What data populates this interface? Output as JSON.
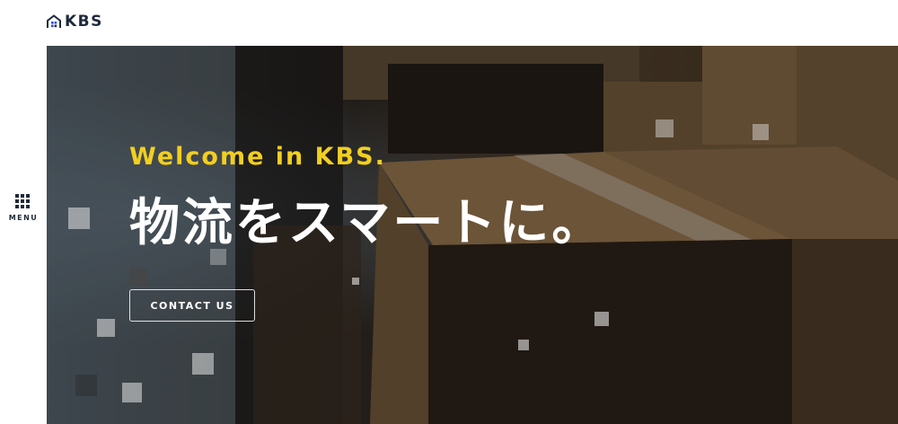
{
  "header": {
    "logo_text": "KBS",
    "logo_icon": "house-icon",
    "brand_color": "#1e2a3a",
    "icon_accent": "#2b4fd6"
  },
  "side_menu": {
    "label": "MENU",
    "icon": "grid-menu-icon"
  },
  "hero": {
    "welcome": "Welcome in KBS.",
    "headline": "物流をスマートに。",
    "cta_label": "CONTACT US",
    "welcome_color": "#f2cf1f"
  }
}
